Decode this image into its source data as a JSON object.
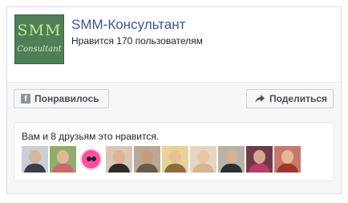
{
  "page": {
    "name": "SMM-Консультант",
    "likes_text": "Нравится 170 пользователям",
    "logo_top": "SMM",
    "logo_bottom": "Consultant"
  },
  "actions": {
    "like_label": "Понравилось",
    "share_label": "Поделиться",
    "like_icon": "facebook-icon",
    "share_icon": "share-arrow-icon"
  },
  "friends": {
    "text": "Вам и 8 друзьям это нравится.",
    "avatars": [
      {
        "name": "friend-avatar-1",
        "bg": "#c9cfd6",
        "skin": "#d8b59a",
        "cloth": "#3b3f45"
      },
      {
        "name": "friend-avatar-2",
        "bg": "#8fae6b",
        "skin": "#e2b797",
        "cloth": "#c86a6a"
      },
      {
        "name": "friend-avatar-3",
        "type": "pink-face"
      },
      {
        "name": "friend-avatar-4",
        "bg": "#d9c6b5",
        "skin": "#e0b291",
        "cloth": "#2f2a2a"
      },
      {
        "name": "friend-avatar-5",
        "bg": "#b8a996",
        "skin": "#c79b7a",
        "cloth": "#6b5b4b"
      },
      {
        "name": "friend-avatar-6",
        "bg": "#e7d39a",
        "skin": "#e8c193",
        "cloth": "#8b6d3b"
      },
      {
        "name": "friend-avatar-7",
        "bg": "#e6d5c3",
        "skin": "#eac6a6",
        "cloth": "#d4b58e"
      },
      {
        "name": "friend-avatar-8",
        "bg": "#b9b2a8",
        "skin": "#d7b193",
        "cloth": "#2d2f34"
      },
      {
        "name": "friend-avatar-9",
        "bg": "#6f3b4a",
        "skin": "#d8a790",
        "cloth": "#b83b6a"
      },
      {
        "name": "friend-avatar-10",
        "bg": "#c8786a",
        "skin": "#e8b598",
        "cloth": "#a0362f"
      }
    ]
  },
  "colors": {
    "link": "#365899",
    "border": "#dddfe2",
    "button_bg": "#f6f7f9"
  }
}
